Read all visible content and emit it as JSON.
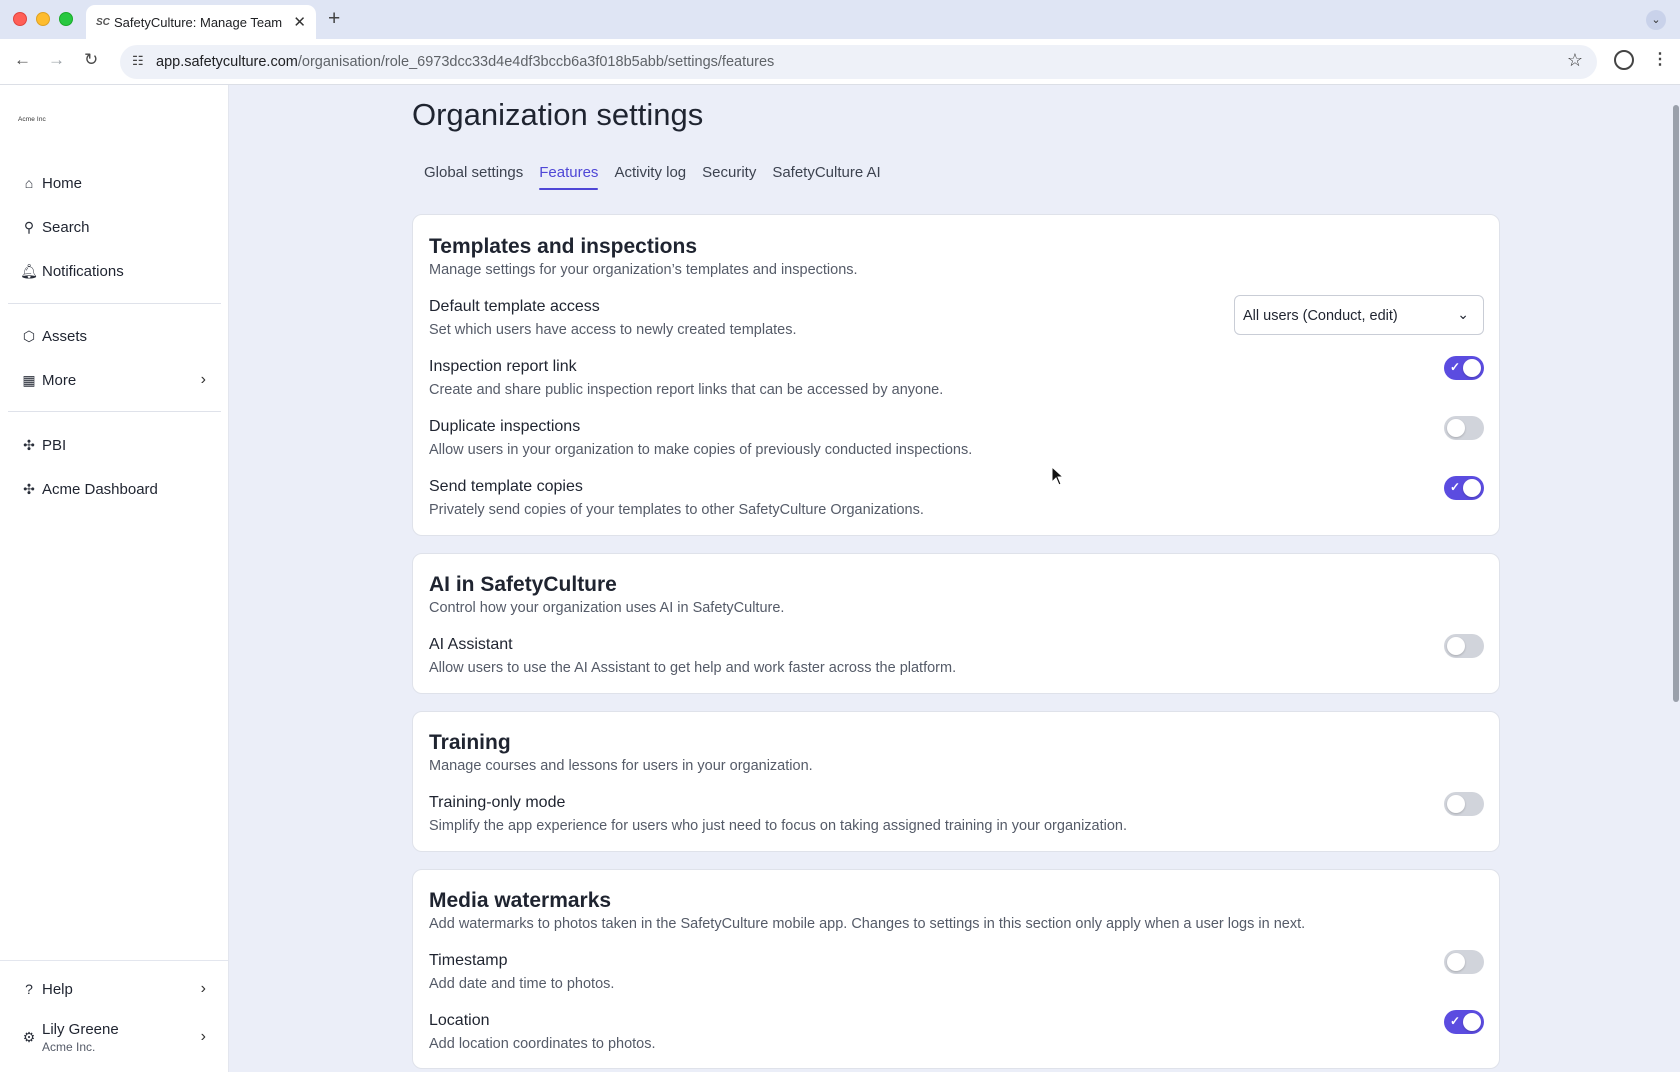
{
  "browser": {
    "tab_title": "SafetyCulture: Manage Teams",
    "tab_favicon": "SC",
    "url_domain": "app.safetyculture.com",
    "url_path": "/organisation/role_6973dcc33d4e4df3bccb6a3f018b5abb/settings/features"
  },
  "sidebar": {
    "org_logo_text": "Acme Inc",
    "items": [
      {
        "label": "Home",
        "icon": "home-icon"
      },
      {
        "label": "Search",
        "icon": "search-icon"
      },
      {
        "label": "Notifications",
        "icon": "bell-icon"
      },
      {
        "label": "Assets",
        "icon": "cube-icon"
      },
      {
        "label": "More",
        "icon": "grid-icon"
      },
      {
        "label": "PBI",
        "icon": "puzzle-icon"
      },
      {
        "label": "Acme Dashboard",
        "icon": "puzzle-icon"
      }
    ],
    "help_label": "Help",
    "user_name": "Lily Greene",
    "user_org": "Acme Inc."
  },
  "page": {
    "title": "Organization settings",
    "tabs": [
      {
        "label": "Global settings",
        "active": false
      },
      {
        "label": "Features",
        "active": true
      },
      {
        "label": "Activity log",
        "active": false
      },
      {
        "label": "Security",
        "active": false
      },
      {
        "label": "SafetyCulture AI",
        "active": false
      }
    ]
  },
  "templates": {
    "title": "Templates and inspections",
    "subtitle": "Manage settings for your organization’s templates and inspections.",
    "default_access": {
      "title": "Default template access",
      "desc": "Set which users have access to newly created templates.",
      "value": "All users (Conduct, edit)"
    },
    "report_link": {
      "title": "Inspection report link",
      "desc": "Create and share public inspection report links that can be accessed by anyone.",
      "on": true
    },
    "duplicate": {
      "title": "Duplicate inspections",
      "desc": "Allow users in your organization to make copies of previously conducted inspections.",
      "on": false
    },
    "send_copies": {
      "title": "Send template copies",
      "desc": "Privately send copies of your templates to other SafetyCulture Organizations.",
      "on": true
    }
  },
  "ai": {
    "title": "AI in SafetyCulture",
    "subtitle": "Control how your organization uses AI in SafetyCulture.",
    "assistant": {
      "title": "AI Assistant",
      "desc": "Allow users to use the AI Assistant to get help and work faster across the platform.",
      "on": false
    }
  },
  "training": {
    "title": "Training",
    "subtitle": "Manage courses and lessons for users in your organization.",
    "only_mode": {
      "title": "Training-only mode",
      "desc": "Simplify the app experience for users who just need to focus on taking assigned training in your organization.",
      "on": false
    }
  },
  "watermarks": {
    "title": "Media watermarks",
    "subtitle": "Add watermarks to photos taken in the SafetyCulture mobile app. Changes to settings in this section only apply when a user logs in next.",
    "timestamp": {
      "title": "Timestamp",
      "desc": "Add date and time to photos.",
      "on": false
    },
    "location": {
      "title": "Location",
      "desc": "Add location coordinates to photos.",
      "on": true
    }
  },
  "colors": {
    "accent": "#4f47d6",
    "toggle_on": "#5b4ce0",
    "toggle_off": "#d1d4db"
  }
}
